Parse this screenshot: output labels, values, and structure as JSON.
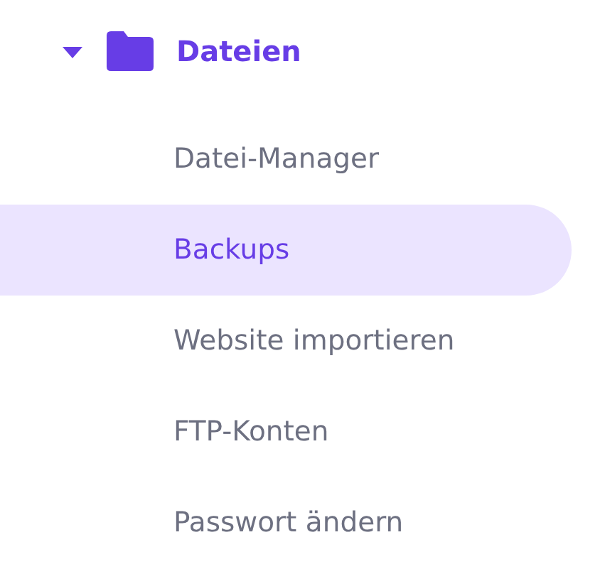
{
  "section": {
    "label": "Dateien",
    "expanded": true
  },
  "items": [
    {
      "label": "Datei-Manager",
      "selected": false
    },
    {
      "label": "Backups",
      "selected": true
    },
    {
      "label": "Website importieren",
      "selected": false
    },
    {
      "label": "FTP-Konten",
      "selected": false
    },
    {
      "label": "Passwort ändern",
      "selected": false
    }
  ]
}
